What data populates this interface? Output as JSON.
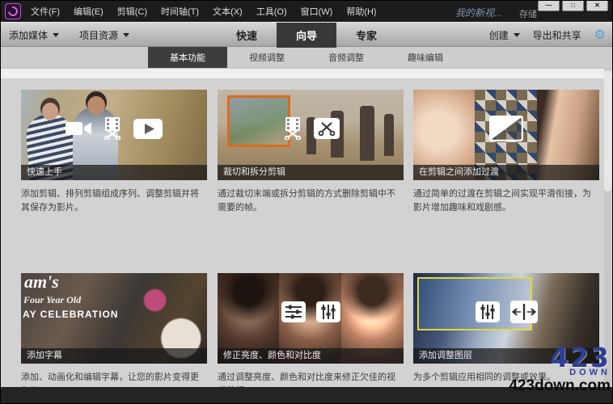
{
  "titlebar": {
    "menus": [
      {
        "label": "文件(F)"
      },
      {
        "label": "编辑(E)"
      },
      {
        "label": "剪辑(C)"
      },
      {
        "label": "时间轴(T)"
      },
      {
        "label": "文本(X)"
      },
      {
        "label": "工具(O)"
      },
      {
        "label": "窗口(W)"
      },
      {
        "label": "帮助(H)"
      }
    ],
    "project_title": "我的新视...",
    "save_label": "存储",
    "window_controls": {
      "minimize": "—",
      "maximize": "□",
      "close": "✕"
    }
  },
  "toolbar": {
    "add_media": "添加媒体",
    "project_assets": "项目资源",
    "mode_tabs": [
      {
        "label": "快速"
      },
      {
        "label": "向导",
        "selected": true
      },
      {
        "label": "专家"
      }
    ],
    "create": "创建",
    "export_share": "导出和共享",
    "gear_glyph": "⚙"
  },
  "category_tabs": [
    {
      "label": "基本功能",
      "selected": true
    },
    {
      "label": "视频调整"
    },
    {
      "label": "音频调整"
    },
    {
      "label": "趣味编辑"
    }
  ],
  "cards": [
    {
      "title": "快速上手",
      "desc": "添加剪辑、排列剪辑组成序列、调整剪辑并将其保存为影片。"
    },
    {
      "title": "裁切和拆分剪辑",
      "desc": "通过裁切末端或拆分剪辑的方式删除剪辑中不需要的帧。"
    },
    {
      "title": "在剪辑之间添加过渡",
      "desc": "通过简单的过渡在剪辑之间实现平滑衔接，为影片增加趣味和戏剧感。"
    },
    {
      "title": "添加字幕",
      "desc": "添加、动画化和编辑字幕，让您的影片变得更生动。"
    },
    {
      "title": "修正亮度、颜色和对比度",
      "desc": "通过调整亮度、颜色和对比度来修正欠佳的视频剪辑。"
    },
    {
      "title": "添加调整图层",
      "desc": "为多个剪辑应用相同的调整或效果。"
    }
  ],
  "card4_overlay": {
    "line1": "am's",
    "line2": "Four Year Old",
    "line3": "AY CELEBRATION"
  },
  "watermark": {
    "big": "423",
    "small": "DOWN",
    "url": "423down.com"
  },
  "colors": {
    "gear": "#4f9fd4",
    "selected_tab": "#383838",
    "crop_frame": "#dd6a1e",
    "adjustment_frame": "#e3d63f"
  }
}
